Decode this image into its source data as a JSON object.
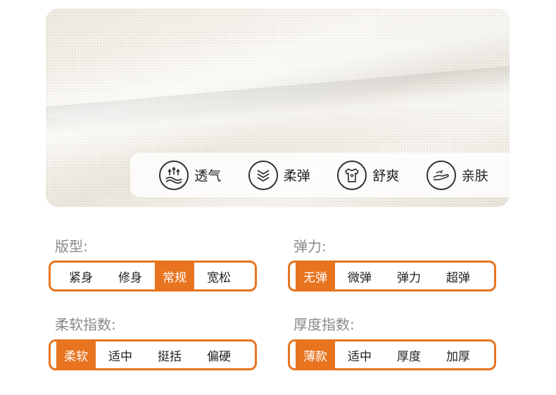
{
  "features": [
    {
      "icon": "breathable-arrows-icon",
      "label": "透气"
    },
    {
      "icon": "elastic-waves-icon",
      "label": "柔弹"
    },
    {
      "icon": "tshirt-icon",
      "label": "舒爽"
    },
    {
      "icon": "hand-skin-icon",
      "label": "亲肤"
    }
  ],
  "colors": {
    "accent": "#e8741f",
    "label_gray": "#8a8a8a"
  },
  "specs": {
    "fit": {
      "label": "版型:",
      "options": [
        "紧身",
        "修身",
        "常规",
        "宽松"
      ],
      "selected": "常规"
    },
    "elasticity": {
      "label": "弹力:",
      "options": [
        "无弹",
        "微弹",
        "弹力",
        "超弹"
      ],
      "selected": "无弹"
    },
    "softness": {
      "label": "柔软指数:",
      "options": [
        "柔软",
        "适中",
        "挺括",
        "偏硬"
      ],
      "selected": "柔软"
    },
    "thickness": {
      "label": "厚度指数:",
      "options": [
        "薄款",
        "适中",
        "厚度",
        "加厚"
      ],
      "selected": "薄款"
    }
  }
}
